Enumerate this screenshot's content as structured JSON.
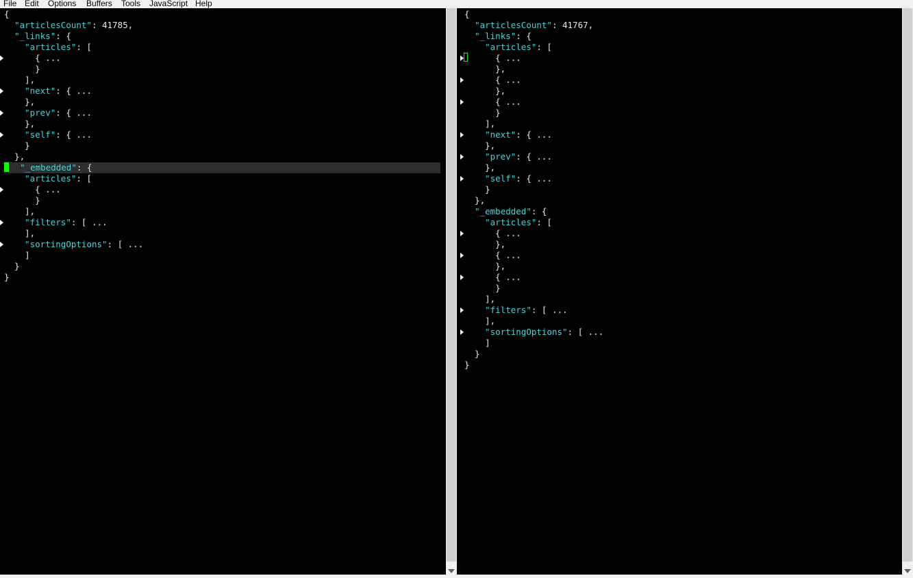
{
  "menubar": {
    "items": [
      "File",
      "Edit",
      "Options",
      "Buffers",
      "Tools",
      "JavaScript",
      "Help"
    ]
  },
  "left_pane": {
    "lines": [
      [
        [
          "p",
          "{"
        ]
      ],
      [
        [
          "p",
          "  "
        ],
        [
          "k",
          "\"articlesCount\""
        ],
        [
          "p",
          ": 41785,"
        ]
      ],
      [
        [
          "p",
          "  "
        ],
        [
          "k",
          "\"_links\""
        ],
        [
          "p",
          ": {"
        ]
      ],
      [
        [
          "p",
          "    "
        ],
        [
          "k",
          "\"articles\""
        ],
        [
          "p",
          ": ["
        ]
      ],
      [
        [
          "p",
          "      { ..."
        ]
      ],
      [
        [
          "p",
          "      }"
        ]
      ],
      [
        [
          "p",
          "    ],"
        ]
      ],
      [
        [
          "p",
          "    "
        ],
        [
          "k",
          "\"next\""
        ],
        [
          "p",
          ": { ..."
        ]
      ],
      [
        [
          "p",
          "    },"
        ]
      ],
      [
        [
          "p",
          "    "
        ],
        [
          "k",
          "\"prev\""
        ],
        [
          "p",
          ": { ..."
        ]
      ],
      [
        [
          "p",
          "    },"
        ]
      ],
      [
        [
          "p",
          "    "
        ],
        [
          "k",
          "\"self\""
        ],
        [
          "p",
          ": { ..."
        ]
      ],
      [
        [
          "p",
          "    }"
        ]
      ],
      [
        [
          "p",
          "  },"
        ]
      ],
      [
        [
          "p",
          "  "
        ],
        [
          "k",
          "\"_embedded\""
        ],
        [
          "p",
          ": {"
        ]
      ],
      [
        [
          "p",
          "    "
        ],
        [
          "k",
          "\"articles\""
        ],
        [
          "p",
          ": ["
        ]
      ],
      [
        [
          "p",
          "      { ..."
        ]
      ],
      [
        [
          "p",
          "      }"
        ]
      ],
      [
        [
          "p",
          "    ],"
        ]
      ],
      [
        [
          "p",
          "    "
        ],
        [
          "k",
          "\"filters\""
        ],
        [
          "p",
          ": [ ..."
        ]
      ],
      [
        [
          "p",
          "    ],"
        ]
      ],
      [
        [
          "p",
          "    "
        ],
        [
          "k",
          "\"sortingOptions\""
        ],
        [
          "p",
          ": [ ..."
        ]
      ],
      [
        [
          "p",
          "    ]"
        ]
      ],
      [
        [
          "p",
          "  }"
        ]
      ],
      [
        [
          "p",
          "}"
        ]
      ]
    ],
    "fold_lines": [
      4,
      7,
      9,
      11,
      16,
      19,
      21
    ],
    "current_line": 14
  },
  "right_pane": {
    "lines": [
      [
        [
          "p",
          "{"
        ]
      ],
      [
        [
          "p",
          "  "
        ],
        [
          "k",
          "\"articlesCount\""
        ],
        [
          "p",
          ": 41767,"
        ]
      ],
      [
        [
          "p",
          "  "
        ],
        [
          "k",
          "\"_links\""
        ],
        [
          "p",
          ": {"
        ]
      ],
      [
        [
          "p",
          "    "
        ],
        [
          "k",
          "\"articles\""
        ],
        [
          "p",
          ": ["
        ]
      ],
      [
        [
          "p",
          "      { ..."
        ]
      ],
      [
        [
          "p",
          "      },"
        ]
      ],
      [
        [
          "p",
          "      { ..."
        ]
      ],
      [
        [
          "p",
          "      },"
        ]
      ],
      [
        [
          "p",
          "      { ..."
        ]
      ],
      [
        [
          "p",
          "      }"
        ]
      ],
      [
        [
          "p",
          "    ],"
        ]
      ],
      [
        [
          "p",
          "    "
        ],
        [
          "k",
          "\"next\""
        ],
        [
          "p",
          ": { ..."
        ]
      ],
      [
        [
          "p",
          "    },"
        ]
      ],
      [
        [
          "p",
          "    "
        ],
        [
          "k",
          "\"prev\""
        ],
        [
          "p",
          ": { ..."
        ]
      ],
      [
        [
          "p",
          "    },"
        ]
      ],
      [
        [
          "p",
          "    "
        ],
        [
          "k",
          "\"self\""
        ],
        [
          "p",
          ": { ..."
        ]
      ],
      [
        [
          "p",
          "    }"
        ]
      ],
      [
        [
          "p",
          "  },"
        ]
      ],
      [
        [
          "p",
          "  "
        ],
        [
          "k",
          "\"_embedded\""
        ],
        [
          "p",
          ": {"
        ]
      ],
      [
        [
          "p",
          "    "
        ],
        [
          "k",
          "\"articles\""
        ],
        [
          "p",
          ": ["
        ]
      ],
      [
        [
          "p",
          "      { ..."
        ]
      ],
      [
        [
          "p",
          "      },"
        ]
      ],
      [
        [
          "p",
          "      { ..."
        ]
      ],
      [
        [
          "p",
          "      },"
        ]
      ],
      [
        [
          "p",
          "      { ..."
        ]
      ],
      [
        [
          "p",
          "      }"
        ]
      ],
      [
        [
          "p",
          "    ],"
        ]
      ],
      [
        [
          "p",
          "    "
        ],
        [
          "k",
          "\"filters\""
        ],
        [
          "p",
          ": [ ..."
        ]
      ],
      [
        [
          "p",
          "    ],"
        ]
      ],
      [
        [
          "p",
          "    "
        ],
        [
          "k",
          "\"sortingOptions\""
        ],
        [
          "p",
          ": [ ..."
        ]
      ],
      [
        [
          "p",
          "    ]"
        ]
      ],
      [
        [
          "p",
          "  }"
        ]
      ],
      [
        [
          "p",
          "}"
        ]
      ]
    ],
    "fold_lines": [
      4,
      6,
      8,
      11,
      13,
      15,
      20,
      22,
      24,
      27,
      29
    ]
  },
  "colors": {
    "background": "#000000",
    "key": "#40d8d8",
    "text": "#e8e8e8",
    "cursor": "#00ff00",
    "current_line": "#2e2e2e",
    "fold_marker": "#ffffff"
  },
  "icons": {
    "fold_marker": "triangle-right-icon",
    "scroll_down": "arrow-down-icon"
  }
}
